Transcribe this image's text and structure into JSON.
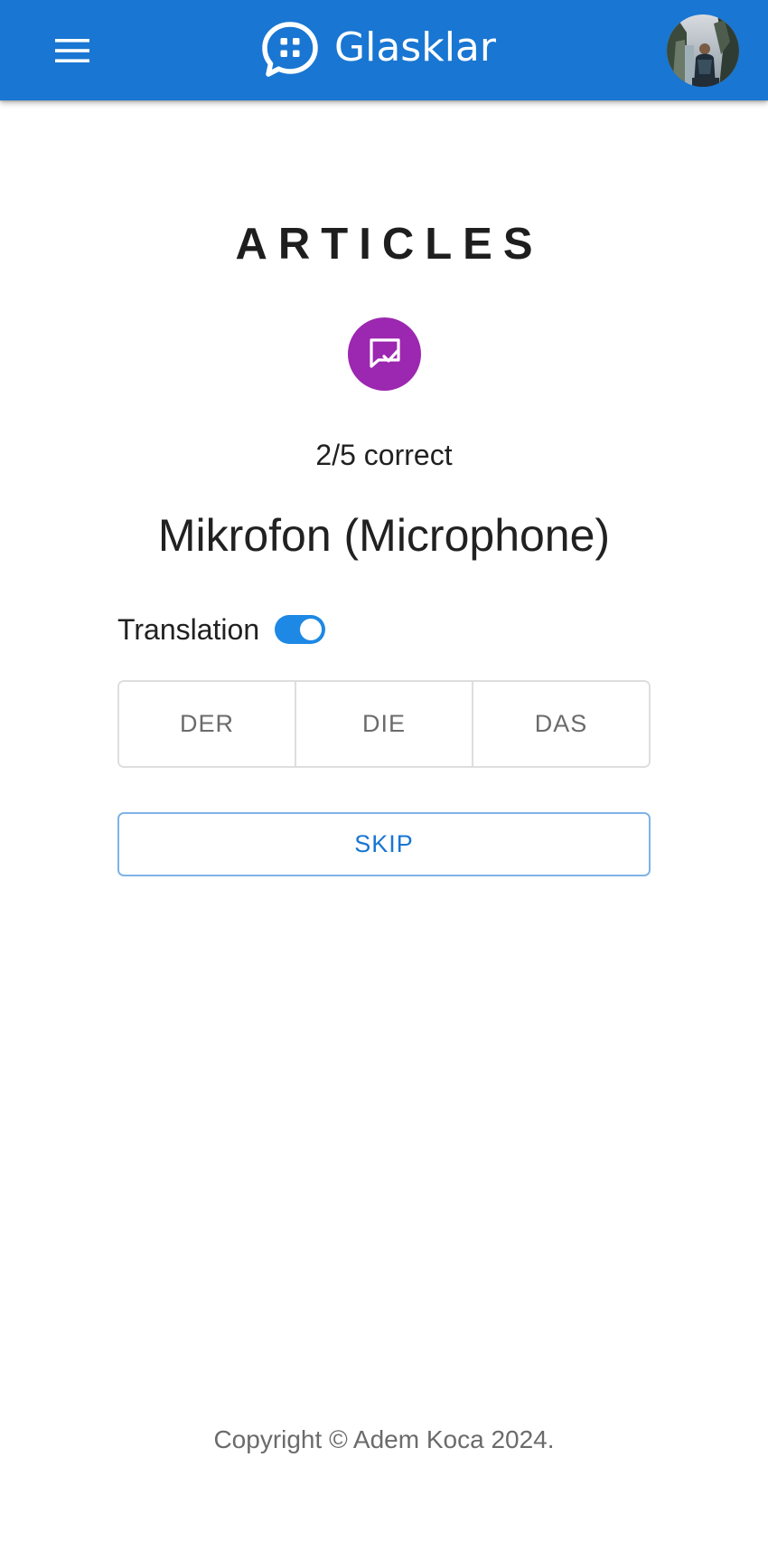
{
  "header": {
    "brand_name": "Glasklar",
    "menu_icon": "menu-icon",
    "logo_icon": "chat-bubble-logo-icon",
    "avatar": "user-avatar-photo",
    "bar_color": "#1976d2"
  },
  "main": {
    "title": "ARTICLES",
    "quiz_icon": "quiz-feedback-icon",
    "quiz_icon_color": "#9c27b0",
    "score": "2/5 correct",
    "word": "Mikrofon (Microphone)",
    "translation_label": "Translation",
    "translation_enabled": true,
    "answers": [
      "DER",
      "DIE",
      "DAS"
    ],
    "skip_label": "SKIP"
  },
  "footer": {
    "copyright": "Copyright © Adem Koca 2024."
  }
}
